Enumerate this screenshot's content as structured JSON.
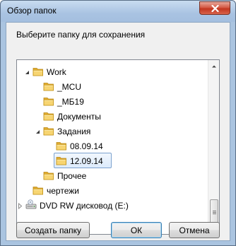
{
  "window": {
    "title": "Обзор папок"
  },
  "prompt": "Выберите папку для сохранения",
  "tree": {
    "items": [
      {
        "label": "Work",
        "level": 2,
        "expander": "expanded",
        "selected": false,
        "icon": "folder-icon"
      },
      {
        "label": "_MCU",
        "level": 3,
        "expander": "none",
        "selected": false,
        "icon": "folder-icon"
      },
      {
        "label": "_МБ19",
        "level": 3,
        "expander": "none",
        "selected": false,
        "icon": "folder-icon"
      },
      {
        "label": "Документы",
        "level": 3,
        "expander": "none",
        "selected": false,
        "icon": "folder-icon"
      },
      {
        "label": "Задания",
        "level": 3,
        "expander": "expanded",
        "selected": false,
        "icon": "folder-icon"
      },
      {
        "label": "08.09.14",
        "level": 4,
        "expander": "none",
        "selected": false,
        "icon": "folder-icon"
      },
      {
        "label": "12.09.14",
        "level": 4,
        "expander": "none",
        "selected": true,
        "icon": "folder-icon"
      },
      {
        "label": "Прочее",
        "level": 3,
        "expander": "none",
        "selected": false,
        "icon": "folder-icon"
      },
      {
        "label": "чертежи",
        "level": 2,
        "expander": "none",
        "selected": false,
        "icon": "folder-icon"
      },
      {
        "label": "DVD RW дисковод (E:)",
        "level": 1,
        "expander": "collapsed",
        "selected": false,
        "icon": "dvd-drive-icon"
      }
    ]
  },
  "buttons": {
    "new_folder": "Создать папку",
    "ok": "ОК",
    "cancel": "Отмена"
  },
  "colors": {
    "selection_border": "#7da2ce",
    "folder_yellow": "#f3c64b",
    "titlebar": "#a9c3e2",
    "close_red": "#c3361f"
  }
}
